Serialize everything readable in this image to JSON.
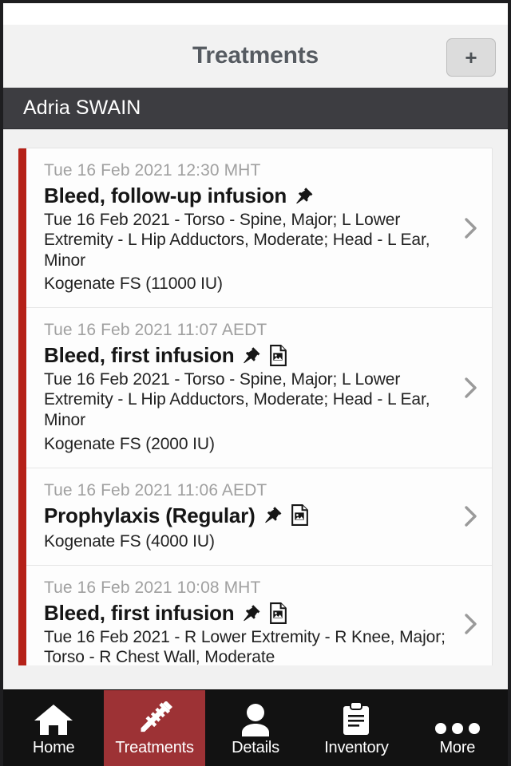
{
  "colors": {
    "accent_red": "#9d3235",
    "card_bar_red": "#b52118",
    "header_bg": "#f2f2f2",
    "patient_bar_bg": "#3d3d41",
    "tab_bar_bg": "#121212",
    "title_text": "#565b61",
    "page_bg": "#f1f1f1"
  },
  "header": {
    "title": "Treatments",
    "add_label": "+",
    "add_icon": "plus-icon"
  },
  "patient": {
    "name": "Adria SWAIN"
  },
  "list": {
    "items": [
      {
        "timestamp": "Tue 16 Feb 2021 12:30 MHT",
        "title": "Bleed, follow-up infusion",
        "icons": [
          "pin-icon"
        ],
        "detail": "Tue 16 Feb 2021 - Torso - Spine, Major; L Lower Extremity - L Hip Adductors, Moderate; Head - L Ear, Minor",
        "product": "Kogenate FS (11000 IU)",
        "chevron": "chevron-right-icon"
      },
      {
        "timestamp": "Tue 16 Feb 2021 11:07 AEDT",
        "title": "Bleed, first infusion",
        "icons": [
          "pin-icon",
          "image-document-icon"
        ],
        "detail": "Tue 16 Feb 2021 - Torso - Spine, Major; L Lower Extremity - L Hip Adductors, Moderate; Head - L Ear, Minor",
        "product": "Kogenate FS (2000 IU)",
        "chevron": "chevron-right-icon"
      },
      {
        "timestamp": "Tue 16 Feb 2021 11:06 AEDT",
        "title": "Prophylaxis (Regular)",
        "icons": [
          "pin-icon",
          "image-document-icon"
        ],
        "detail": "",
        "product": "Kogenate FS (4000 IU)",
        "chevron": "chevron-right-icon"
      },
      {
        "timestamp": "Tue 16 Feb 2021 10:08 MHT",
        "title": "Bleed, first infusion",
        "icons": [
          "pin-icon",
          "image-document-icon"
        ],
        "detail": "Tue 16 Feb 2021 - R Lower Extremity - R Knee, Major; Torso - R Chest Wall, Moderate",
        "product": "",
        "chevron": "chevron-right-icon"
      }
    ]
  },
  "tabs": [
    {
      "label": "Home",
      "icon": "home-icon",
      "active": false
    },
    {
      "label": "Treatments",
      "icon": "syringe-icon",
      "active": true
    },
    {
      "label": "Details",
      "icon": "person-icon",
      "active": false
    },
    {
      "label": "Inventory",
      "icon": "clipboard-icon",
      "active": false
    },
    {
      "label": "More",
      "icon": "ellipsis-icon",
      "active": false
    }
  ]
}
